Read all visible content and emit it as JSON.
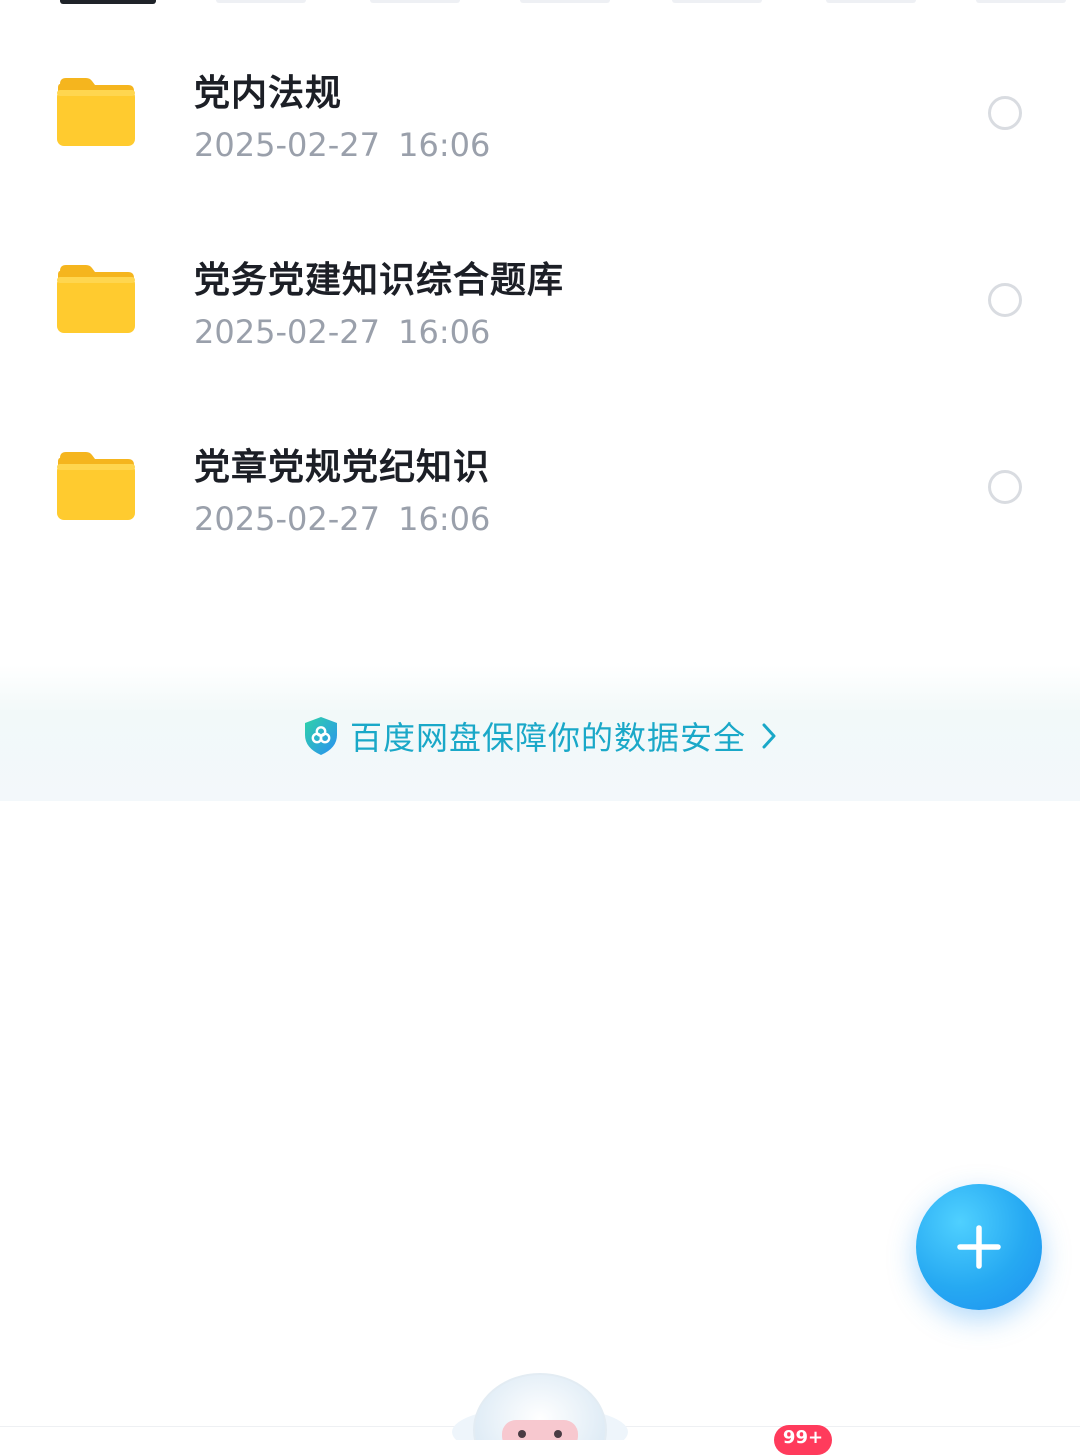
{
  "files": [
    {
      "name": "党内法规",
      "modified": "2025-02-27  16:06"
    },
    {
      "name": "党务党建知识综合题库",
      "modified": "2025-02-27  16:06"
    },
    {
      "name": "党章党规党纪知识",
      "modified": "2025-02-27  16:06"
    }
  ],
  "banner": {
    "text": "百度网盘保障你的数据安全",
    "icon": "shield-icon",
    "accent_color": "#1aa8c8"
  },
  "fab": {
    "icon": "plus-icon",
    "color": "#26a9f2"
  },
  "bottom_nav": {
    "badge": "99+",
    "badge_color": "#ff3b5c"
  },
  "colors": {
    "folder": "#ffc928",
    "title_text": "#1c1f26",
    "meta_text": "#9aa0ab"
  }
}
